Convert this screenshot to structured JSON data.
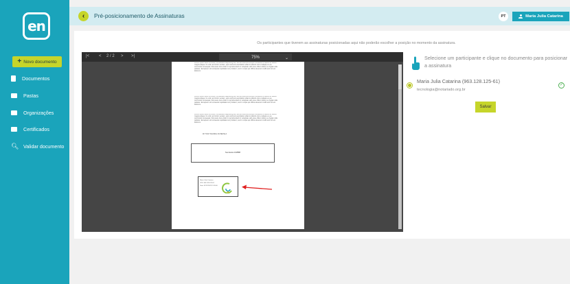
{
  "sidebar": {
    "logo_text": "en",
    "new_document_label": "Novo documento",
    "items": [
      {
        "label": "Documentos",
        "icon": "document-icon"
      },
      {
        "label": "Pastas",
        "icon": "folder-icon"
      },
      {
        "label": "Organizações",
        "icon": "organization-icon"
      },
      {
        "label": "Certificados",
        "icon": "certificate-icon"
      },
      {
        "label": "Validar documento",
        "icon": "search-icon"
      }
    ]
  },
  "header": {
    "title": "Pré-posicionamento de Assinaturas",
    "language_badge": "PT",
    "user_name": "Maria Julia Catarina"
  },
  "notice": "Os participantes que tiverem as assinaturas posicionadas aqui não poderão escolher a posição no momento da assinatura.",
  "viewer": {
    "first_page": "|<",
    "prev_page": "<",
    "page_indicator": "2 / 2",
    "next_page": ">",
    "last_page": ">|",
    "zoom": "75%",
    "zoom_caret": "⌄"
  },
  "document": {
    "paragraph1": "Lorem ipsum dolor sit amet, consectetur adipiscing elit, sed do eiusmod tempor incididunt ut labore et dolore magna aliqua. Ut enim ad minim veniam, quis nostrud exercitation ullamco laboris nisi ut aliquip ex ea commodo consequat. Duis aute irure dolor in reprehenderit in voluptate velit esse cillum dolore eu fugiat nulla pariatur. Excepteur sint occaecat cupidatat non proident, sunt in culpa qui officia deserunt mollit anim id est laborum.",
    "paragraph2": "Lorem ipsum dolor sit amet, consectetur adipiscing elit, sed do eiusmod tempor incididunt ut labore et dolore magna aliqua. Ut enim ad minim veniam, quis nostrud exercitation ullamco laboris nisi ut aliquip ex ea commodo consequat. Duis aute irure dolor in reprehenderit in voluptate velit esse cillum dolore eu fugiat nulla pariatur. Excepteur sint occaecat cupidatat non proident, sunt in culpa qui officia deserunt mollit anim id est laborum.",
    "paragraph3": "Lorem ipsum dolor sit amet, consectetur adipiscing elit, sed do eiusmod tempor incididunt ut labore et dolore magna aliqua. Ut enim ad minim veniam, quis nostrud exercitation ullamco laboris nisi ut aliquip ex ea commodo consequat. Duis aute irure dolor in reprehenderit in voluptate velit esse cillum dolore eu fugiat nulla pariatur. Excepteur sint occaecat cupidatat non proident, sunt in culpa qui officia deserunt mollit anim id est laborum.",
    "representative_label": "MY TEST SIGNING ON BEHALF",
    "signature_box_text": "Sua Assina 1418888",
    "stamp_lines": [
      "Maria Julia Catarina",
      "CPF: 963.128.125-61",
      "Data: 01/11/2023 12:45:00"
    ]
  },
  "panel": {
    "instruction": "Selecione um participante e clique no documento para posicionar a assinatura",
    "participant_name": "Maria Julia Catarina (963.128.125-61)",
    "participant_email": "tecnologia@notariado.org.br",
    "status_glyph": "✓",
    "save_label": "Salvar"
  },
  "colors": {
    "sidebar": "#1aa4bb",
    "accent": "#c6d52a",
    "header_bg": "#d3ecf1",
    "viewer_bg": "#454545",
    "arrow": "#e02020"
  }
}
